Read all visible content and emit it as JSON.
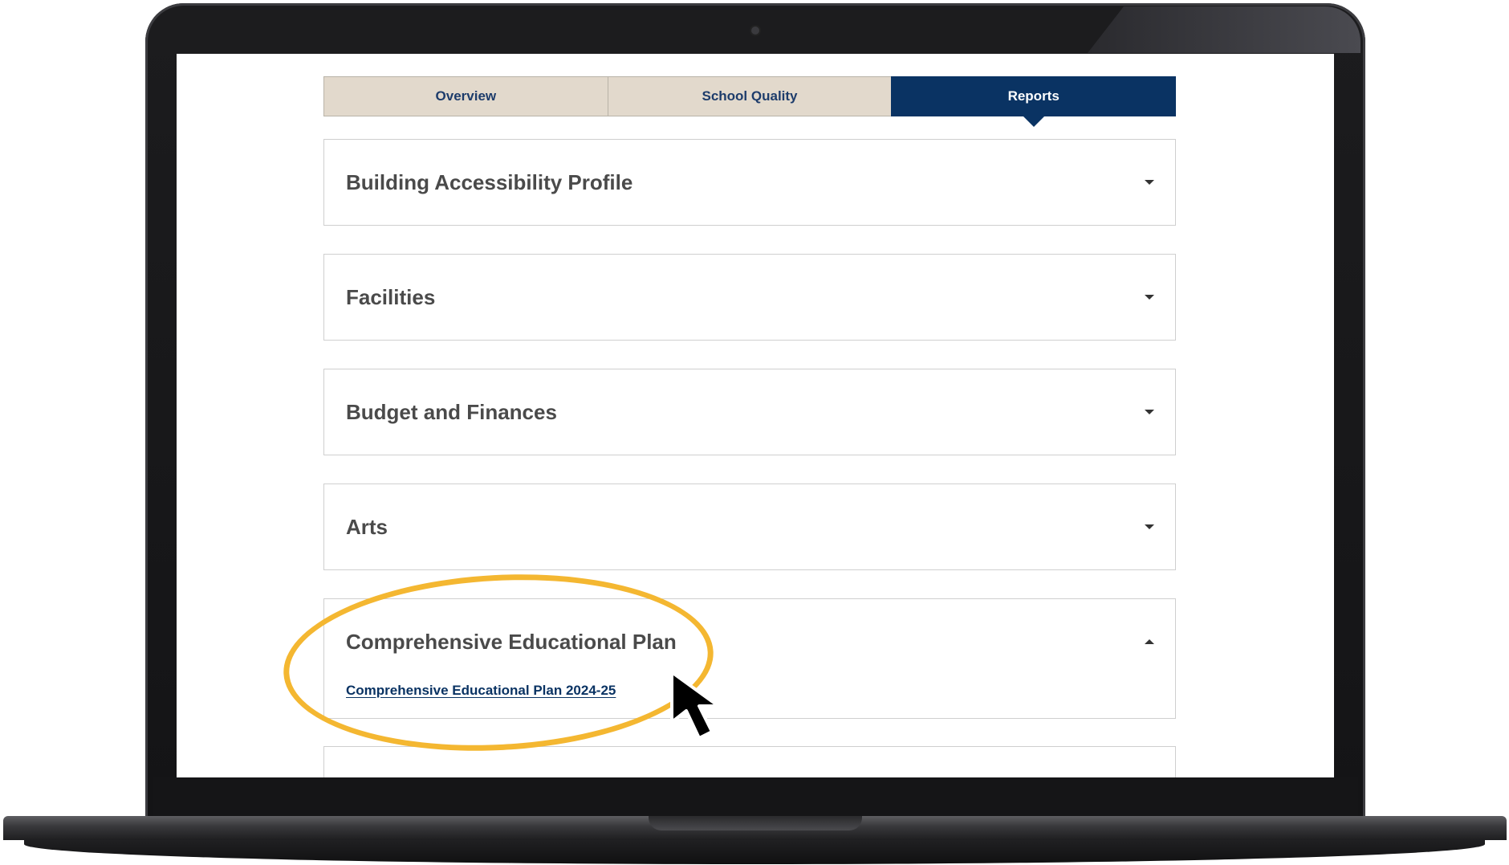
{
  "tabs": [
    {
      "label": "Overview",
      "active": false
    },
    {
      "label": "School Quality",
      "active": false
    },
    {
      "label": "Reports",
      "active": true
    }
  ],
  "sections": [
    {
      "title": "Building Accessibility Profile",
      "expanded": false
    },
    {
      "title": "Facilities",
      "expanded": false
    },
    {
      "title": "Budget and Finances",
      "expanded": false
    },
    {
      "title": "Arts",
      "expanded": false
    },
    {
      "title": "Comprehensive Educational Plan",
      "expanded": true,
      "link": "Comprehensive Educational Plan 2024-25"
    }
  ],
  "colors": {
    "tab_bg": "#e2d9cc",
    "active_tab": "#0a3363",
    "highlight": "#f4b731"
  },
  "icons": {
    "collapsed": "caret-down-icon",
    "expanded": "caret-up-icon",
    "pointer": "mouse-cursor-icon"
  }
}
